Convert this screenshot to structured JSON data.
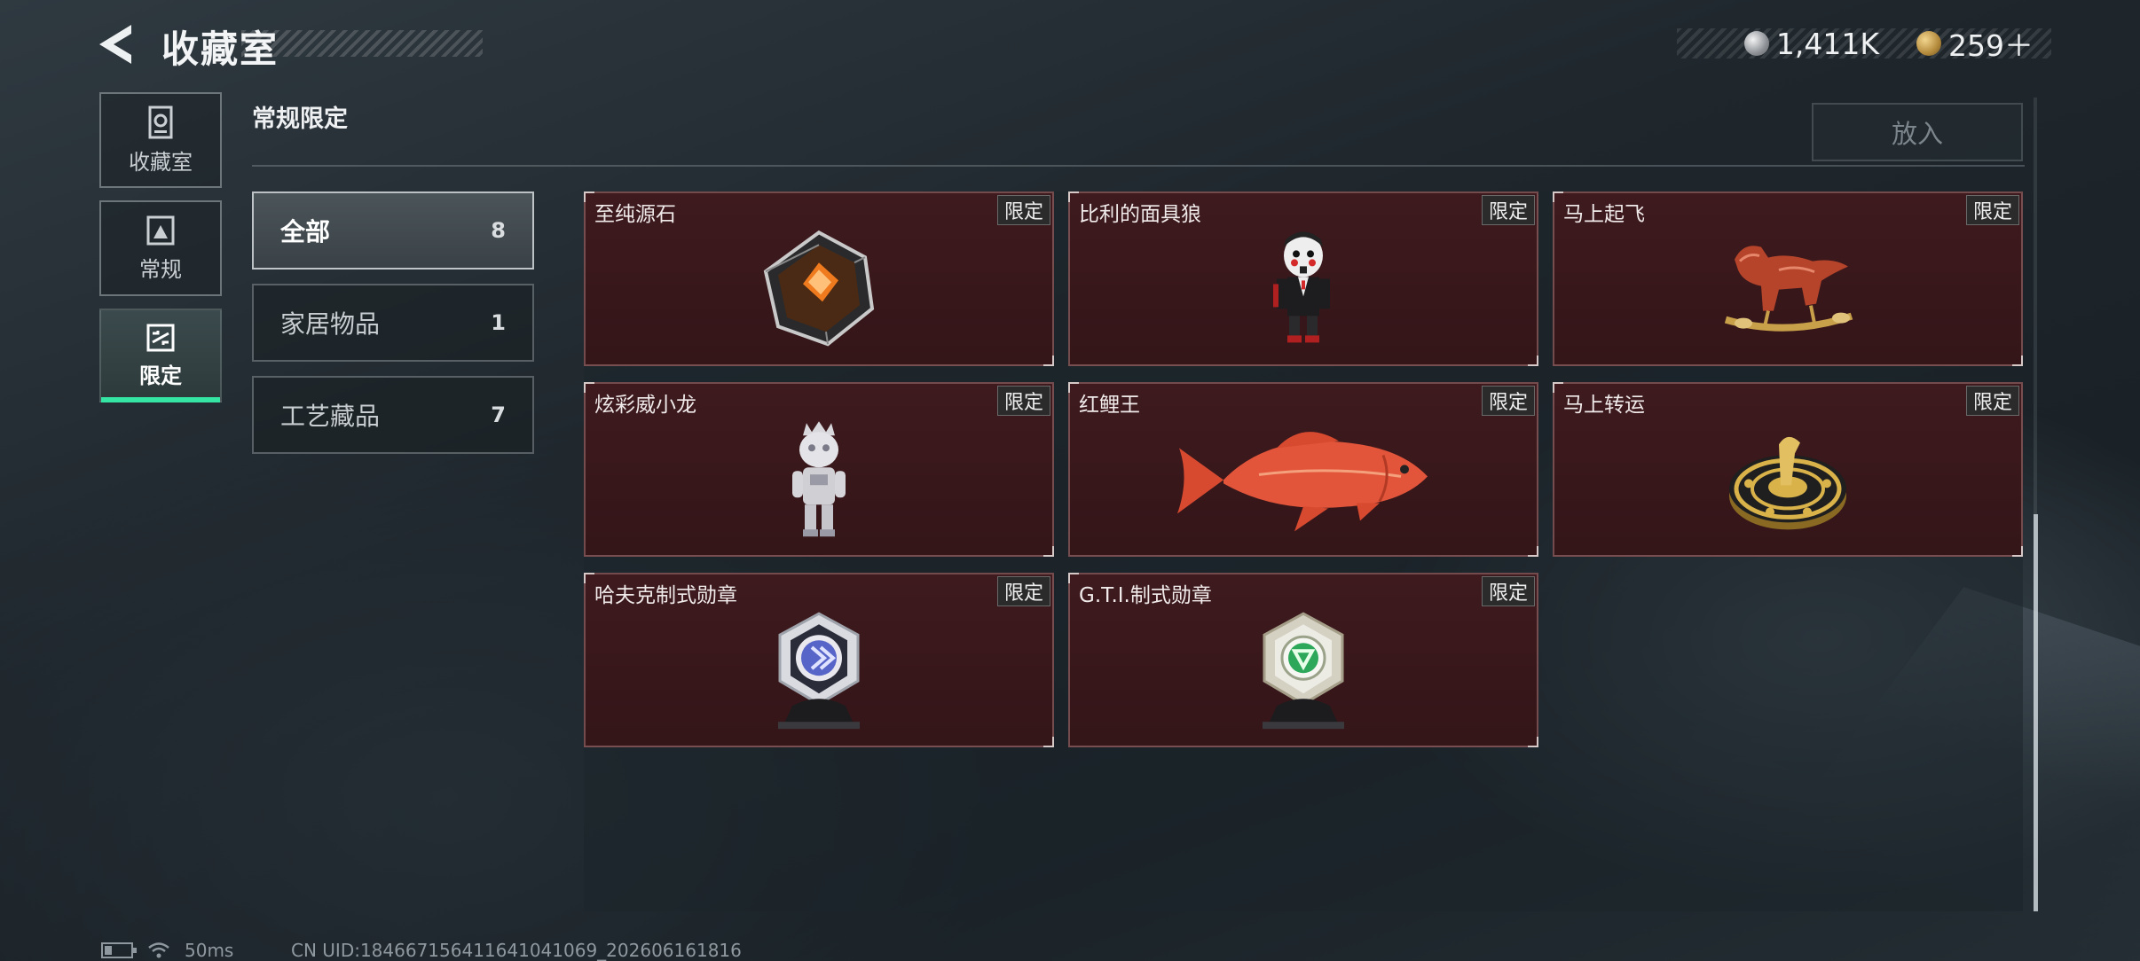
{
  "header": {
    "title": "收藏室",
    "currencies": [
      {
        "icon": "silver-coin-icon",
        "value": "1,411K"
      },
      {
        "icon": "gold-coin-icon",
        "value": "259＋"
      }
    ]
  },
  "nav": {
    "items": [
      {
        "label": "收藏室",
        "icon": "collection-room-icon",
        "active": false
      },
      {
        "label": "常规",
        "icon": "regular-icon",
        "active": false
      },
      {
        "label": "限定",
        "icon": "limited-icon",
        "active": true
      }
    ]
  },
  "section": {
    "title": "常规限定",
    "place_button": "放入"
  },
  "categories": [
    {
      "name": "全部",
      "count": "8",
      "active": true
    },
    {
      "name": "家居物品",
      "count": "1",
      "active": false
    },
    {
      "name": "工艺藏品",
      "count": "7",
      "active": false
    }
  ],
  "items": [
    {
      "name": "至纯源石",
      "badge": "限定",
      "art": "gem-icon"
    },
    {
      "name": "比利的面具狼",
      "badge": "限定",
      "art": "puppet-figure-icon"
    },
    {
      "name": "马上起飞",
      "badge": "限定",
      "art": "rocking-horse-icon"
    },
    {
      "name": "炫彩威小龙",
      "badge": "限定",
      "art": "dragon-figure-icon"
    },
    {
      "name": "红鲤王",
      "badge": "限定",
      "art": "carp-fish-icon"
    },
    {
      "name": "马上转运",
      "badge": "限定",
      "art": "horse-compass-icon"
    },
    {
      "name": "哈夫克制式勋章",
      "badge": "限定",
      "art": "blue-medal-icon"
    },
    {
      "name": "G.T.I.制式勋章",
      "badge": "限定",
      "art": "green-medal-icon"
    }
  ],
  "status": {
    "ping": "50ms",
    "uid": "CN UID:184667156411641041069_202606161816"
  },
  "colors": {
    "accent": "#35e5a4",
    "card_bg": "#3e1a1e",
    "background": "#1f272d"
  }
}
